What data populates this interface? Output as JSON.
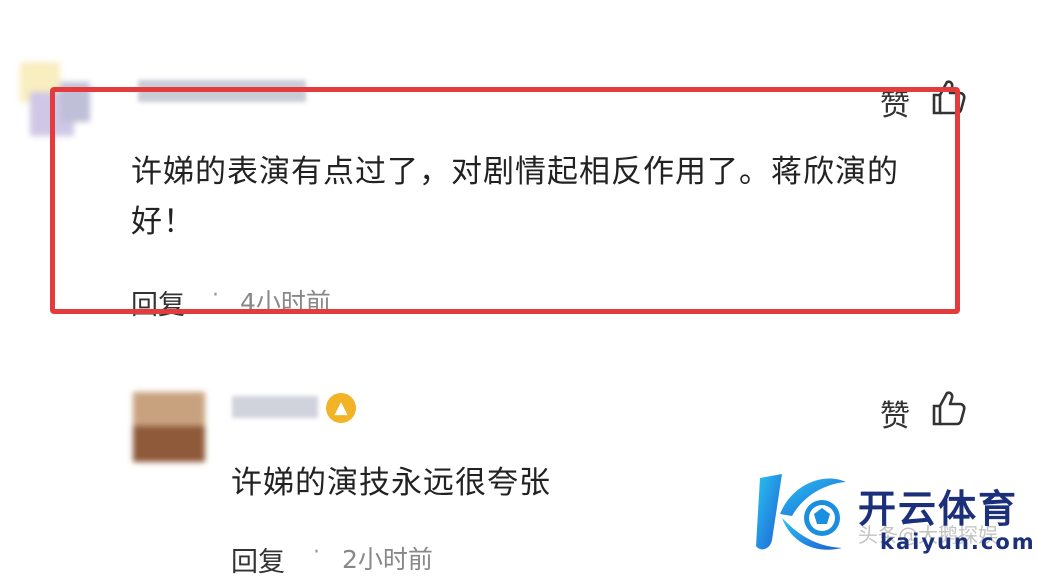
{
  "comments": [
    {
      "like_label": "赞",
      "text": "许娣的表演有点过了，对剧情起相反作用了。蒋欣演的好！",
      "reply_label": "回复",
      "separator": "·",
      "time": "4小时前"
    },
    {
      "like_label": "赞",
      "text": "许娣的演技永远很夸张",
      "reply_label": "回复",
      "separator": "·",
      "time": "2小时前"
    }
  ],
  "watermark": {
    "brand_cn": "开云体育",
    "brand_en": "kaiyun.com",
    "sub": "头条@大鹅探娱"
  },
  "colors": {
    "highlight_border": "#e43c3c",
    "brand": "#1c2f7a",
    "badge": "#f2b327"
  }
}
